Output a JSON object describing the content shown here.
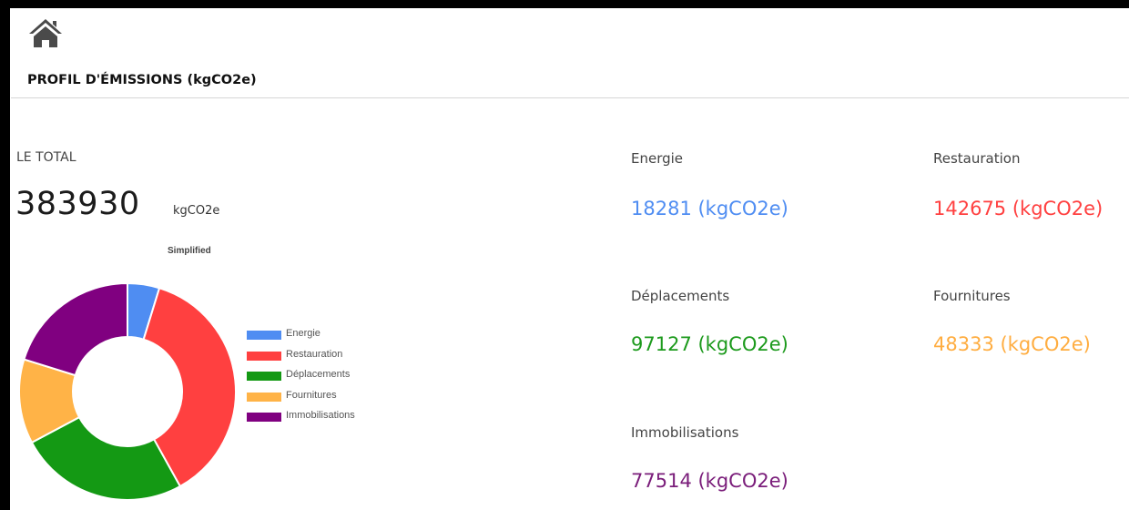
{
  "header": {
    "home_icon": "home-icon",
    "title": "PROFIL D'ÉMISSIONS (kgCO2e)"
  },
  "total": {
    "label": "LE TOTAL",
    "value": "383930",
    "unit": "kgCO2e"
  },
  "stats": [
    {
      "label": "Energie",
      "value": "18281 (kgCO2e)",
      "color": "#4f8df2"
    },
    {
      "label": "Restauration",
      "value": "142675 (kgCO2e)",
      "color": "#ff4040"
    },
    {
      "label": "Déplacements",
      "value": "97127 (kgCO2e)",
      "color": "#1c9a1c"
    },
    {
      "label": "Fournitures",
      "value": "48333 (kgCO2e)",
      "color": "#ffad40"
    },
    {
      "label": "Immobilisations",
      "value": "77514 (kgCO2e)",
      "color": "#7a1d7a"
    }
  ],
  "chart_data": {
    "type": "pie",
    "variant": "donut",
    "title": "Simplified",
    "categories": [
      "Energie",
      "Restauration",
      "Déplacements",
      "Fournitures",
      "Immobilisations"
    ],
    "values": [
      18281,
      142675,
      97127,
      48333,
      77514
    ],
    "colors": [
      "#4f8df2",
      "#ff4040",
      "#149914",
      "#ffb347",
      "#800080"
    ],
    "legend_position": "right"
  }
}
